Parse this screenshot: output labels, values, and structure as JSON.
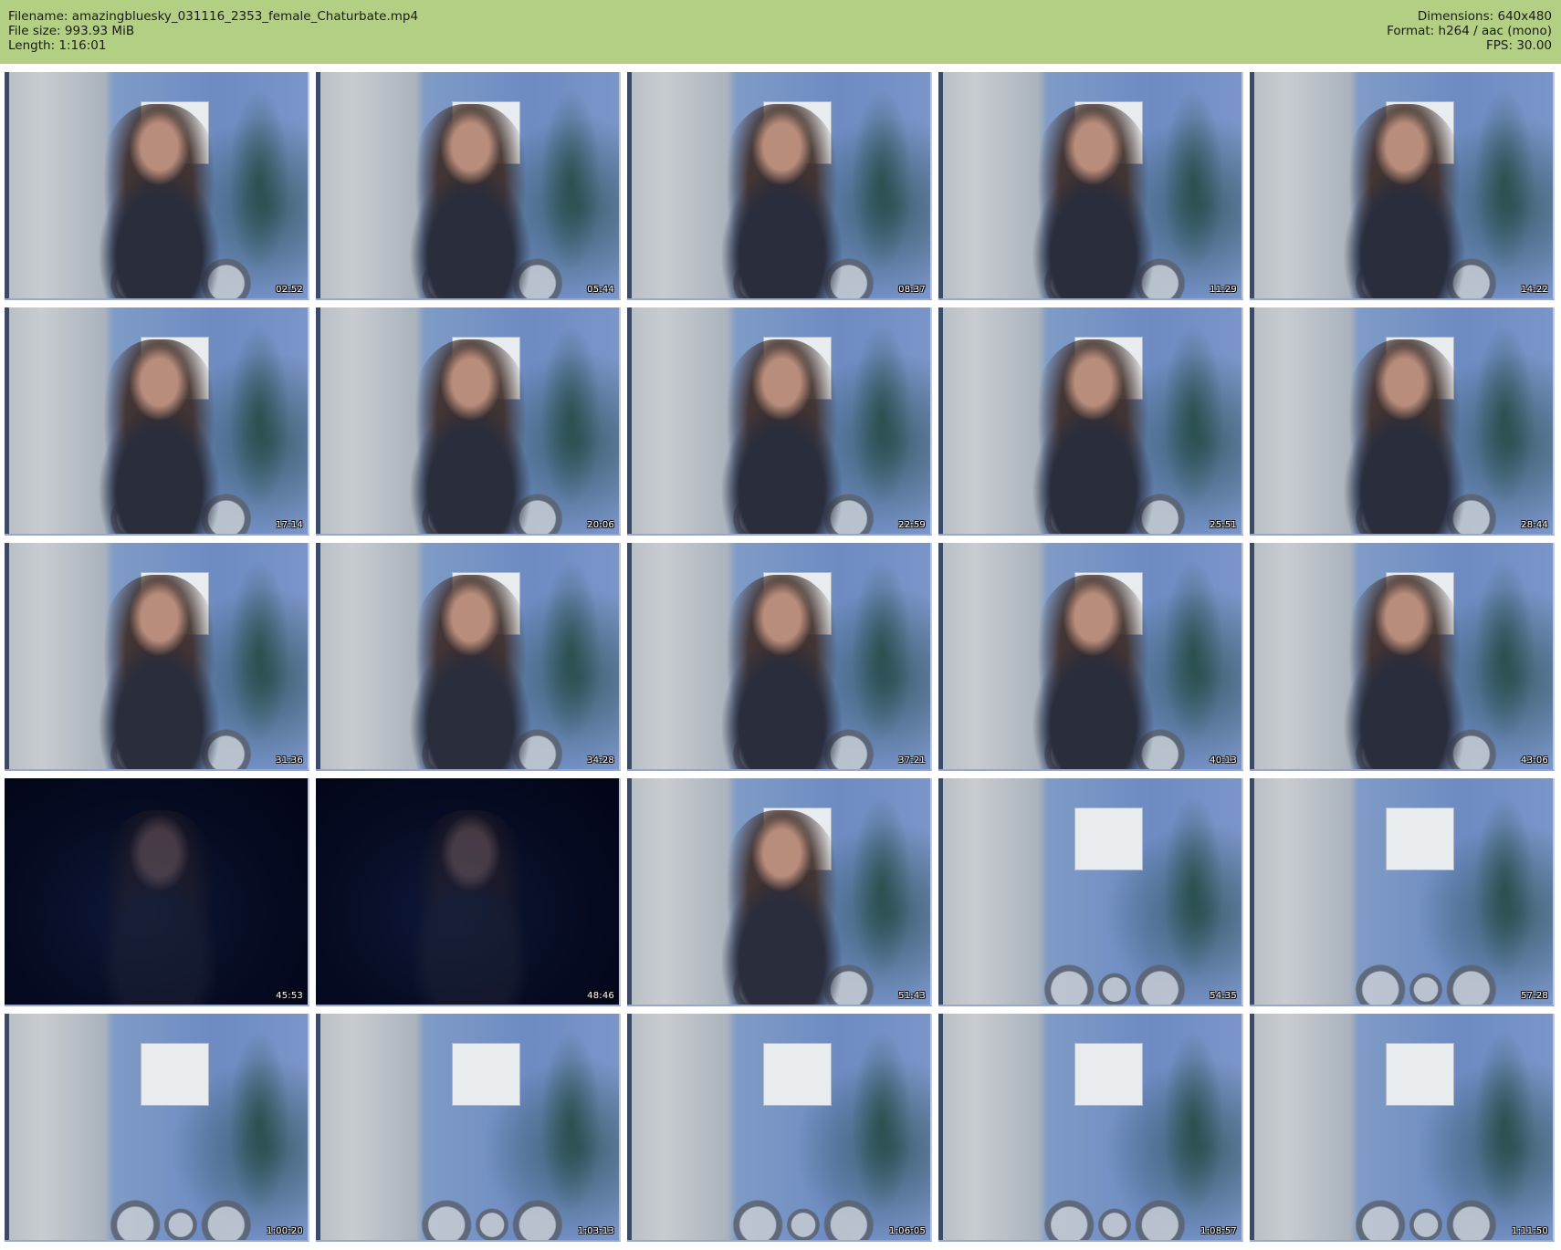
{
  "info": {
    "filename_line": "Filename: amazingbluesky_031116_2353_female_Chaturbate.mp4",
    "filesize_line": "File size: 993.93 MiB",
    "length_line": "Length: 1:16:01",
    "dimensions_line": "Dimensions: 640x480",
    "format_line": "Format: h264 / aac (mono)",
    "fps_line": "FPS: 30.00"
  },
  "colors": {
    "header_background": "#b2cf84",
    "page_background": "#ffffff",
    "timestamp_text": "#ffffff"
  },
  "thumbnails": [
    {
      "time": "02:52",
      "scene": "normal",
      "person": true
    },
    {
      "time": "05:44",
      "scene": "normal",
      "person": true
    },
    {
      "time": "08:37",
      "scene": "normal",
      "person": true
    },
    {
      "time": "11:29",
      "scene": "normal",
      "person": true
    },
    {
      "time": "14:22",
      "scene": "normal",
      "person": true
    },
    {
      "time": "17:14",
      "scene": "normal",
      "person": true
    },
    {
      "time": "20:06",
      "scene": "normal",
      "person": true
    },
    {
      "time": "22:59",
      "scene": "normal",
      "person": true
    },
    {
      "time": "25:51",
      "scene": "normal",
      "person": true
    },
    {
      "time": "28:44",
      "scene": "normal",
      "person": true
    },
    {
      "time": "31:36",
      "scene": "normal",
      "person": true
    },
    {
      "time": "34:28",
      "scene": "normal",
      "person": true
    },
    {
      "time": "37:21",
      "scene": "normal",
      "person": true
    },
    {
      "time": "40:13",
      "scene": "normal",
      "person": true
    },
    {
      "time": "43:06",
      "scene": "normal",
      "person": true
    },
    {
      "time": "45:53",
      "scene": "dark",
      "person": true
    },
    {
      "time": "48:46",
      "scene": "dark",
      "person": true
    },
    {
      "time": "51:43",
      "scene": "normal",
      "person": true
    },
    {
      "time": "54:35",
      "scene": "normal",
      "person": false
    },
    {
      "time": "57:28",
      "scene": "normal",
      "person": false
    },
    {
      "time": "1:00:20",
      "scene": "normal",
      "person": false
    },
    {
      "time": "1:03:13",
      "scene": "normal",
      "person": false
    },
    {
      "time": "1:06:05",
      "scene": "normal",
      "person": false
    },
    {
      "time": "1:08:57",
      "scene": "normal",
      "person": false
    },
    {
      "time": "1:11:50",
      "scene": "normal",
      "person": false
    }
  ]
}
